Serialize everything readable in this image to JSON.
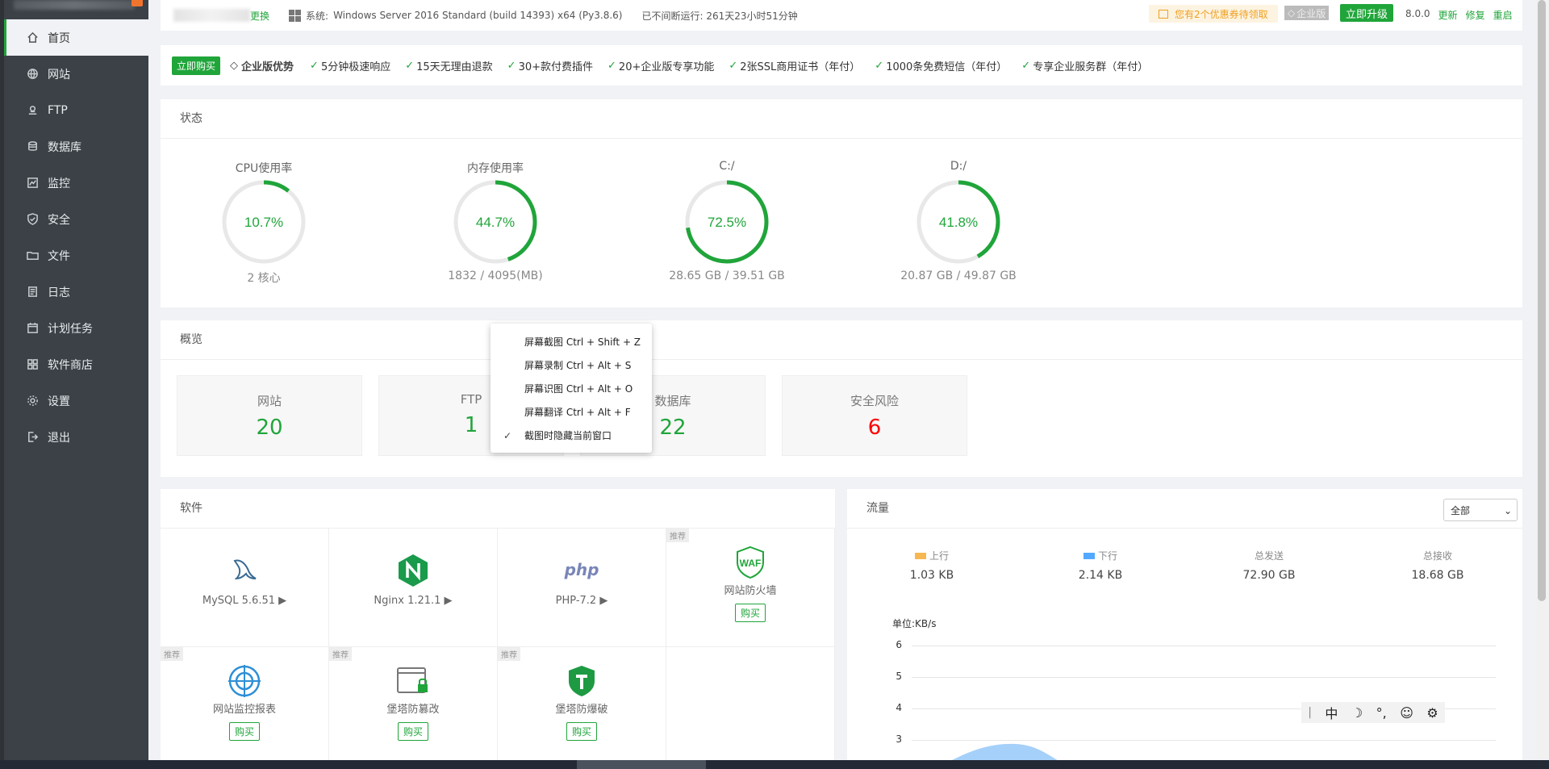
{
  "sidebar": {
    "items": [
      {
        "label": "首页",
        "icon": "home-icon",
        "active": true
      },
      {
        "label": "网站",
        "icon": "globe-icon"
      },
      {
        "label": "FTP",
        "icon": "ftp-icon"
      },
      {
        "label": "数据库",
        "icon": "database-icon"
      },
      {
        "label": "监控",
        "icon": "monitor-icon"
      },
      {
        "label": "安全",
        "icon": "shield-icon"
      },
      {
        "label": "文件",
        "icon": "folder-icon"
      },
      {
        "label": "日志",
        "icon": "log-icon"
      },
      {
        "label": "计划任务",
        "icon": "calendar-icon"
      },
      {
        "label": "软件商店",
        "icon": "grid-icon"
      },
      {
        "label": "设置",
        "icon": "gear-icon"
      },
      {
        "label": "退出",
        "icon": "logout-icon"
      }
    ]
  },
  "topbar": {
    "change": "更换",
    "system_label": "系统:",
    "system_value": "Windows Server 2016 Standard (build 14393) x64 (Py3.8.6)",
    "uptime": "已不间断运行: 261天23小时51分钟",
    "coupon": "您有2个优惠券待领取",
    "enterprise": "企业版",
    "upgrade": "立即升级",
    "version": "8.0.0",
    "update": "更新",
    "repair": "修复",
    "restart": "重启"
  },
  "promo": {
    "buy": "立即购买",
    "title": "企业版优势",
    "features": [
      "5分钟极速响应",
      "15天无理由退款",
      "30+款付费插件",
      "20+企业版专享功能",
      "2张SSL商用证书（年付）",
      "1000条免费短信（年付）",
      "专享企业服务群（年付）"
    ]
  },
  "status": {
    "title": "状态",
    "gauges": [
      {
        "label": "CPU使用率",
        "percent": 10.7,
        "display": "10.7%",
        "sub": "2 核心"
      },
      {
        "label": "内存使用率",
        "percent": 44.7,
        "display": "44.7%",
        "sub": "1832 / 4095(MB)"
      },
      {
        "label": "C:/",
        "percent": 72.5,
        "display": "72.5%",
        "sub": "28.65 GB / 39.51 GB"
      },
      {
        "label": "D:/",
        "percent": 41.8,
        "display": "41.8%",
        "sub": "20.87 GB / 49.87 GB"
      }
    ]
  },
  "overview": {
    "title": "概览",
    "items": [
      {
        "label": "网站",
        "value": "20"
      },
      {
        "label": "FTP",
        "value": "1"
      },
      {
        "label": "数据库",
        "value": "22"
      },
      {
        "label": "安全风险",
        "value": "6"
      }
    ]
  },
  "context_menu": {
    "items": [
      {
        "label": "屏幕截图 Ctrl + Shift + Z"
      },
      {
        "label": "屏幕录制 Ctrl + Alt + S"
      },
      {
        "label": "屏幕识图 Ctrl + Alt + O"
      },
      {
        "label": "屏幕翻译 Ctrl + Alt + F"
      },
      {
        "label": "截图时隐藏当前窗口",
        "checked": true
      }
    ]
  },
  "software": {
    "title": "软件",
    "recommend": "推荐",
    "buy": "购买",
    "items": [
      {
        "name": "MySQL 5.6.51 ▶",
        "icon": "mysql-dolphin-icon"
      },
      {
        "name": "Nginx 1.21.1 ▶",
        "icon": "nginx-icon"
      },
      {
        "name": "PHP-7.2 ▶",
        "icon": "php-icon"
      },
      {
        "name": "网站防火墙",
        "icon": "waf-shield-icon",
        "recommended": true,
        "buyable": true
      },
      {
        "name": "网站监控报表",
        "icon": "site-monitor-icon",
        "recommended": true,
        "buyable": true
      },
      {
        "name": "堡塔防篡改",
        "icon": "tamper-proof-icon",
        "recommended": true,
        "buyable": true
      },
      {
        "name": "堡塔防爆破",
        "icon": "anti-bruteforce-icon",
        "recommended": true,
        "buyable": true
      }
    ]
  },
  "traffic": {
    "title": "流量",
    "select": "全部",
    "stats": [
      {
        "label": "上行",
        "value": "1.03 KB",
        "color": "#f7b851"
      },
      {
        "label": "下行",
        "value": "2.14 KB",
        "color": "#52a9ff"
      },
      {
        "label": "总发送",
        "value": "72.90 GB"
      },
      {
        "label": "总接收",
        "value": "18.68 GB"
      }
    ],
    "unit": "单位:KB/s",
    "yticks": [
      "6",
      "5",
      "4",
      "3"
    ]
  },
  "ime": {
    "items": [
      "中",
      "☽",
      "°,",
      "☺",
      "⚙"
    ]
  },
  "colors": {
    "accent": "#20a53a",
    "danger": "#ff0000",
    "sidebar": "#3b4147"
  }
}
